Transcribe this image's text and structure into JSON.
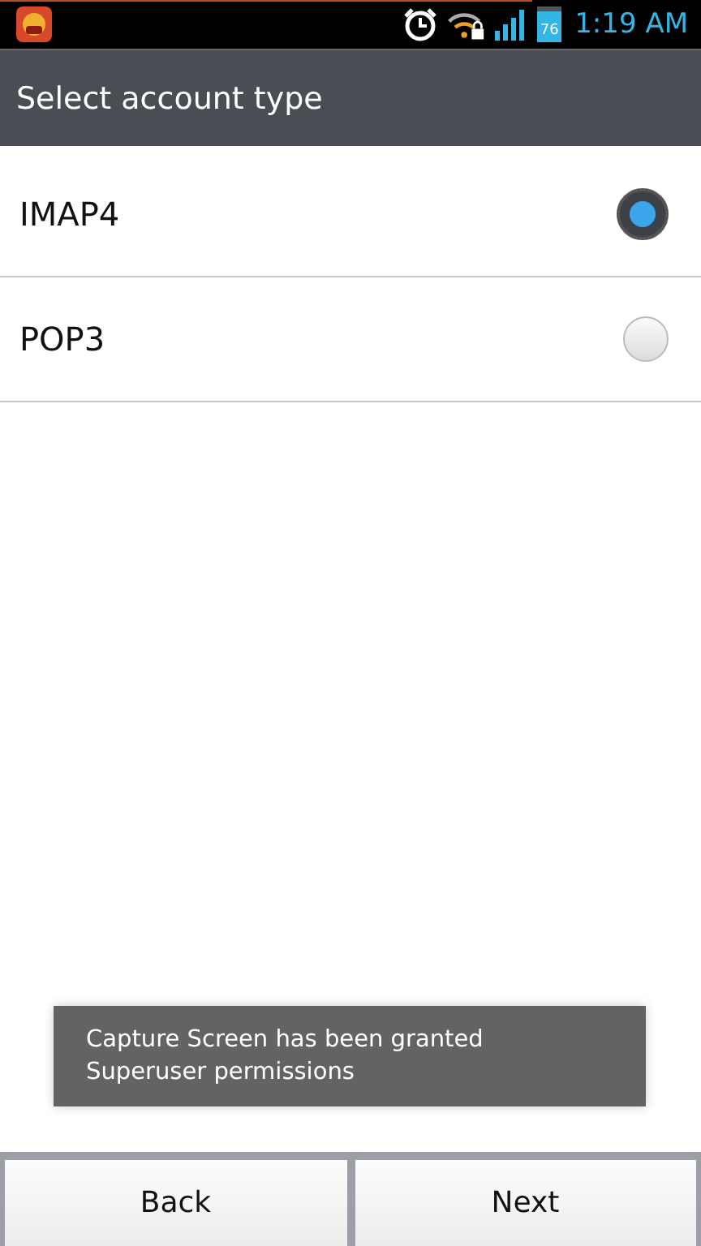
{
  "status_bar": {
    "progress": {
      "level": 0.76
    },
    "battery": "76",
    "time": "1:19 AM"
  },
  "title": "Select account type",
  "options": [
    {
      "label": "IMAP4",
      "selected": true
    },
    {
      "label": "POP3",
      "selected": false
    }
  ],
  "toast": {
    "lines": [
      "Capture Screen has been granted",
      "Superuser permissions"
    ]
  },
  "buttons": [
    "Back",
    "Next"
  ]
}
